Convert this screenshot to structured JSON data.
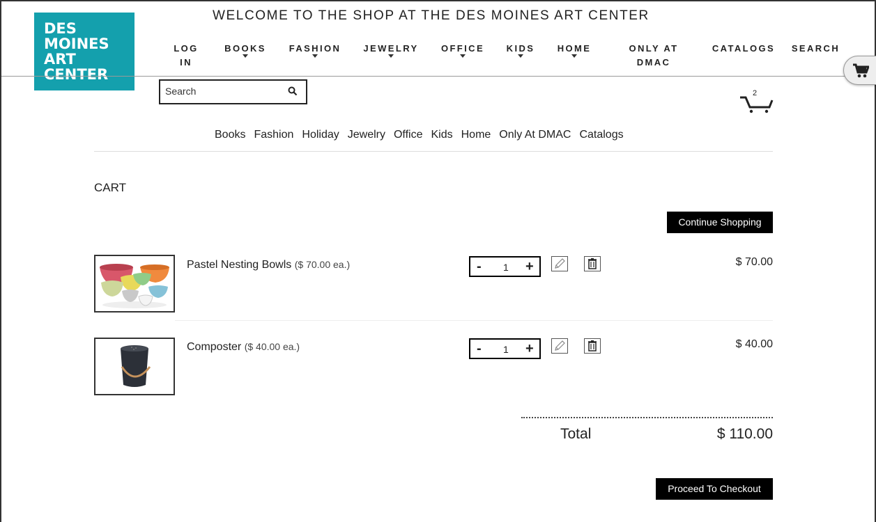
{
  "brand": {
    "logo_lines": [
      "DES",
      "MOINES",
      "ART",
      "CENTER"
    ]
  },
  "header": {
    "welcome": "WELCOME TO THE SHOP AT THE DES MOINES ART CENTER",
    "nav": [
      {
        "line1": "LOG",
        "line2": "IN",
        "caret": false
      },
      {
        "line1": "BOOKS",
        "line2": "",
        "caret": true
      },
      {
        "line1": "FASHION",
        "line2": "",
        "caret": true
      },
      {
        "line1": "JEWELRY",
        "line2": "",
        "caret": true
      },
      {
        "line1": "OFFICE",
        "line2": "",
        "caret": true
      },
      {
        "line1": "KIDS",
        "line2": "",
        "caret": true
      },
      {
        "line1": "HOME",
        "line2": "",
        "caret": true
      },
      {
        "line1": "ONLY AT",
        "line2": "DMAC",
        "caret": false
      },
      {
        "line1": "CATALOGS",
        "line2": "",
        "caret": false
      },
      {
        "line1": "SEARCH",
        "line2": "",
        "caret": false
      }
    ]
  },
  "search": {
    "placeholder": "Search"
  },
  "minicart": {
    "count": "2"
  },
  "subnav": [
    "Books",
    "Fashion",
    "Holiday",
    "Jewelry",
    "Office",
    "Kids",
    "Home",
    "Only At DMAC",
    "Catalogs"
  ],
  "cart": {
    "title": "CART",
    "continue_label": "Continue Shopping",
    "items": [
      {
        "name": "Pastel Nesting Bowls",
        "each": "($ 70.00 ea.)",
        "qty": "1",
        "price": "$ 70.00"
      },
      {
        "name": "Composter",
        "each": "($ 40.00 ea.)",
        "qty": "1",
        "price": "$ 40.00"
      }
    ],
    "qty_minus": "-",
    "qty_plus": "+",
    "total_label": "Total",
    "total_value": "$ 110.00",
    "checkout_label": "Proceed To Checkout"
  },
  "icons": [
    "cart-icon",
    "search-icon",
    "pencil-icon",
    "trash-icon"
  ]
}
